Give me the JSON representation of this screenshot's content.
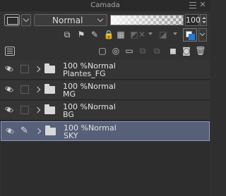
{
  "window": {
    "title": "Camada"
  },
  "blend": {
    "mode": "Normal"
  },
  "opacity": {
    "value": "100",
    "level": 1.0
  },
  "colors": {
    "accent": "#1e7bd6",
    "selection": "#566078"
  },
  "layers": [
    {
      "opacity": "100 %",
      "mode": "Normal",
      "name": "Plantes_FG",
      "selected": false
    },
    {
      "opacity": "100 %",
      "mode": "Normal",
      "name": "MG",
      "selected": false
    },
    {
      "opacity": "100 %",
      "mode": "Normal",
      "name": "BG",
      "selected": false
    },
    {
      "opacity": "100 %",
      "mode": "Normal",
      "name": "SKY",
      "selected": true
    }
  ]
}
